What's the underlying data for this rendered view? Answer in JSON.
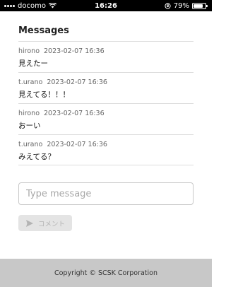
{
  "status_bar": {
    "carrier": "docomo",
    "time": "16:26",
    "battery_percent": "79%",
    "battery_level": 0.79
  },
  "header": {
    "title": "Messages"
  },
  "messages": [
    {
      "user": "hirono",
      "timestamp": "2023-02-07 16:36",
      "text": "見えたー"
    },
    {
      "user": "t.urano",
      "timestamp": "2023-02-07 16:36",
      "text": "見えてる！！！"
    },
    {
      "user": "hirono",
      "timestamp": "2023-02-07 16:36",
      "text": "おーい"
    },
    {
      "user": "t.urano",
      "timestamp": "2023-02-07 16:36",
      "text": "みえてる？"
    }
  ],
  "composer": {
    "placeholder": "Type message",
    "value": "",
    "send_label": "コメント",
    "send_icon": "send-icon"
  },
  "footer": {
    "text": "Copyright © SCSK Corporation"
  }
}
